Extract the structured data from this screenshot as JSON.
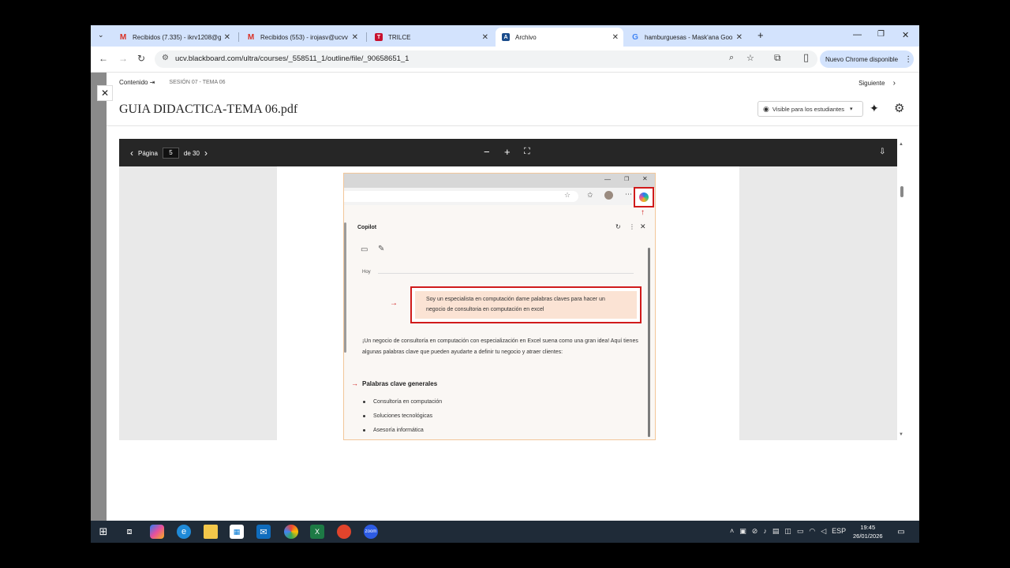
{
  "tabs": [
    {
      "title": "Recibidos (7.335) - ikrv1208@g",
      "icon": "gmail-icon"
    },
    {
      "title": "Recibidos (553) - irojasv@ucvv",
      "icon": "gmail-icon"
    },
    {
      "title": "TRILCE",
      "icon": "trilce-icon"
    },
    {
      "title": "Archivo",
      "icon": "blackboard-icon"
    },
    {
      "title": "hamburguesas - Mask'ana Goo",
      "icon": "google-icon"
    }
  ],
  "address": {
    "url": "ucv.blackboard.com/ultra/courses/_558511_1/outline/file/_90658651_1",
    "update_label": "Nuevo Chrome disponible"
  },
  "page": {
    "crumb_label": "Contenido",
    "session_label": "SESIÓN 07 - TEMA 06",
    "next_label": "Siguiente",
    "title": "GUIA DIDACTICA-TEMA 06.pdf",
    "visibility_label": "Visible para los estudiantes"
  },
  "pdf": {
    "page_label": "Página",
    "current_page": "5",
    "total_label": "de 30"
  },
  "copilot": {
    "label": "Copilot",
    "date_label": "Hoy",
    "prompt": "Soy un especialista en computación dame palabras claves para hacer un negocio de consultoria en computación en excel",
    "answer": "¡Un negocio de consultoría en computación con especialización en Excel suena como una gran idea! Aquí tienes algunas palabras clave que pueden ayudarte a definir tu negocio y atraer clientes:",
    "section_title": "Palabras clave generales",
    "keywords": [
      "Consultoría en computación",
      "Soluciones tecnológicas",
      "Asesoría informática"
    ]
  },
  "taskbar": {
    "lang": "ESP",
    "time": "19:45",
    "date": "26/01/2026"
  },
  "colors": {
    "tabstrip": "#d3e3fd",
    "pdf_toolbar": "#262626",
    "highlight_red": "#d01b1b",
    "taskbar": "#1f2b38"
  }
}
